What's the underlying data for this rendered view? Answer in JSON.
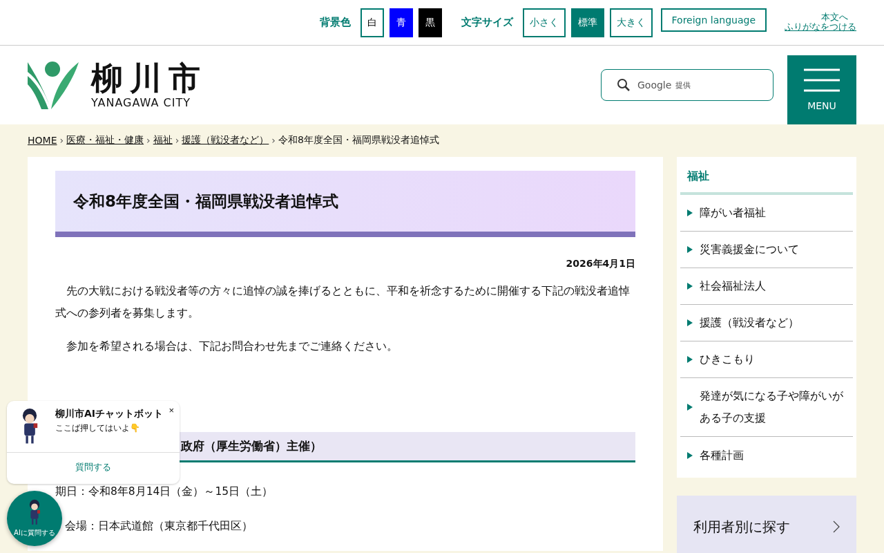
{
  "top_bar": {
    "background_label": "背景色",
    "background_options": [
      {
        "label": "白",
        "color": "#ffffff"
      },
      {
        "label": "青",
        "color": "#0000ff"
      },
      {
        "label": "黒",
        "color": "#000000"
      }
    ],
    "text_size_label": "文字サイズ",
    "text_size_options": [
      {
        "label": "小さく",
        "selected": false
      },
      {
        "label": "標準",
        "selected": true
      },
      {
        "label": "大きく",
        "selected": false
      }
    ],
    "foreign_language": "Foreign language",
    "skip_link": "本文へ",
    "furigana_link": "ふりがなをつける"
  },
  "header": {
    "logo_name": "柳川市",
    "logo_subtitle": "YANAGAWA CITY",
    "search_brand": "Google",
    "search_provided": "提供",
    "menu_label": "MENU"
  },
  "breadcrumb": {
    "separator": "›",
    "items": [
      {
        "label": "HOME",
        "link": true
      },
      {
        "label": "医療・福祉・健康",
        "link": true
      },
      {
        "label": "福祉",
        "link": true
      },
      {
        "label": "援護（戦没者など）",
        "link": true
      },
      {
        "label": "令和8年度全国・福岡県戦没者追悼式",
        "link": false
      }
    ]
  },
  "article": {
    "title": "令和8年度全国・福岡県戦没者追悼式",
    "date": "2026年4月1日",
    "paragraphs": [
      "先の大戦における戦没者等の方々に追悼の誠を捧げるとともに、平和を祈念するために開催する下記の戦没者追悼式への参列者を募集します。",
      "参加を希望される場合は、下記お問合わせ先までご連絡ください。"
    ],
    "section_heading": "政府（厚生労働省）主催）",
    "details": [
      "期日：令和8年8月14日（金）～15日（土）",
      "会場：日本武道館（東京都千代田区）"
    ]
  },
  "sidebar": {
    "heading": "福祉",
    "items": [
      "障がい者福祉",
      "災害義援金について",
      "社会福祉法人",
      "援護（戦没者など）",
      "ひきこもり",
      "発達が気になる子や障がいがある子の支援",
      "各種計画"
    ],
    "user_search": "利用者別に探す"
  },
  "chatbot": {
    "title": "柳川市AIチャットボット",
    "close": "×",
    "message": "ここば押してはいよ👇",
    "action": "質問する",
    "launcher_label": "AIに質問する"
  }
}
